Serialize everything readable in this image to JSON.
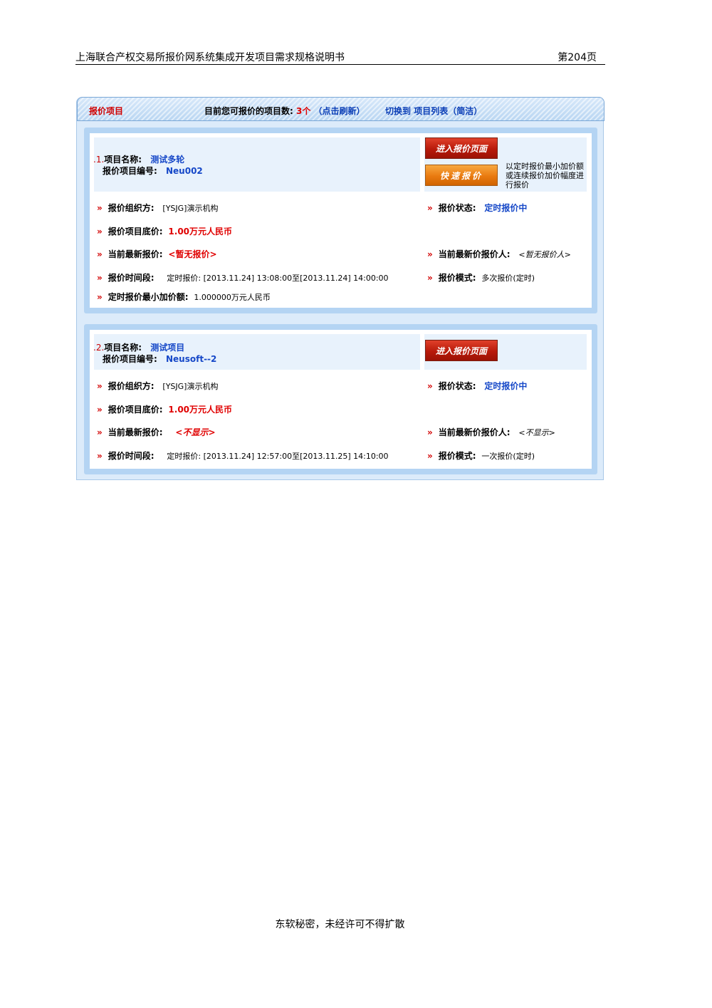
{
  "header": {
    "doc_title": "上海联合产权交易所报价网系统集成开发项目需求规格说明书",
    "page": "第204页"
  },
  "panel": {
    "title": "报价项目",
    "count_prefix": "目前您可报价的项目数:",
    "count": "3个",
    "refresh": "（点击刷新）",
    "switch_label": "切换到",
    "switch_link": "项目列表（简洁）"
  },
  "items": [
    {
      "index": ".1.",
      "name_label": "项目名称:",
      "name": "测试多轮",
      "code_label": "报价项目编号:",
      "code": "Neu002",
      "enter_button": "进入报价页面",
      "quick_button": "快速报价",
      "quick_note": "以定时报价最小加价额或连续报价加价幅度进行报价",
      "org_label": "报价组织方:",
      "org": "[YSJG]演示机构",
      "status_label": "报价状态:",
      "status": "定时报价中",
      "base_label": "报价项目底价:",
      "base": "1.00万元人民币",
      "latest_label": "当前最新报价:",
      "latest": "<暂无报价>",
      "bidder_label": "当前最新价报价人:",
      "bidder": "<暂无报价人>",
      "period_label": "报价时间段:",
      "period": "定时报价: [2013.11.24] 13:08:00至[2013.11.24] 14:00:00",
      "mode_label": "报价模式:",
      "mode": "多次报价(定时)",
      "min_inc_label": "定时报价最小加价额:",
      "min_inc": "1.000000万元人民币"
    },
    {
      "index": ".2.",
      "name_label": "项目名称:",
      "name": "测试项目",
      "code_label": "报价项目编号:",
      "code": "Neusoft--2",
      "enter_button": "进入报价页面",
      "org_label": "报价组织方:",
      "org": "[YSJG]演示机构",
      "status_label": "报价状态:",
      "status": "定时报价中",
      "base_label": "报价项目底价:",
      "base": "1.00万元人民币",
      "latest_label": "当前最新报价:",
      "latest": "<不显示>",
      "bidder_label": "当前最新价报价人:",
      "bidder": "<不显示>",
      "period_label": "报价时间段:",
      "period": "定时报价: [2013.11.24] 12:57:00至[2013.11.25] 14:10:00",
      "mode_label": "报价模式:",
      "mode": "一次报价(定时)"
    }
  ],
  "footer": {
    "text": "东软秘密，未经许可不得扩散"
  }
}
